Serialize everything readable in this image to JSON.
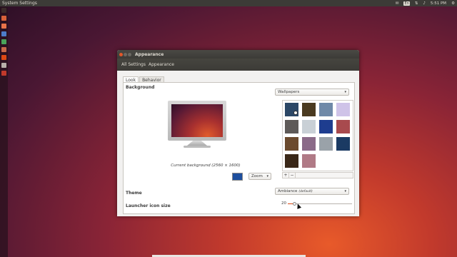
{
  "top_panel": {
    "title": "System Settings",
    "keyboard": "En",
    "clock": "5:51 PM"
  },
  "window": {
    "title": "Appearance",
    "toolbar": {
      "all_settings": "All Settings",
      "current": "Appearance"
    },
    "tabs": [
      {
        "label": "Look",
        "active": true
      },
      {
        "label": "Behavior",
        "active": false
      }
    ],
    "background": {
      "label": "Background",
      "source": "Wallpapers",
      "caption": "Current background (2560 × 1600)",
      "color": "#1e4f9e",
      "mode": "Zoom"
    },
    "wallpaper_colors": [
      "#2b4766",
      "#4a3a20",
      "#6f89a8",
      "#cfc3e8",
      "#5e5a58",
      "#c9d0d6",
      "#1e3d8f",
      "#a84a4e",
      "#6b4a2e",
      "#8a6a88",
      "#9aa2a9",
      "#1b3a63",
      "#3a2818",
      "#b07a86"
    ],
    "add_label": "+",
    "remove_label": "−",
    "theme": {
      "label": "Theme",
      "value": "Ambiance",
      "note": "(default)"
    },
    "launcher": {
      "label": "Launcher icon size",
      "value": "20",
      "level": 0.1
    }
  }
}
